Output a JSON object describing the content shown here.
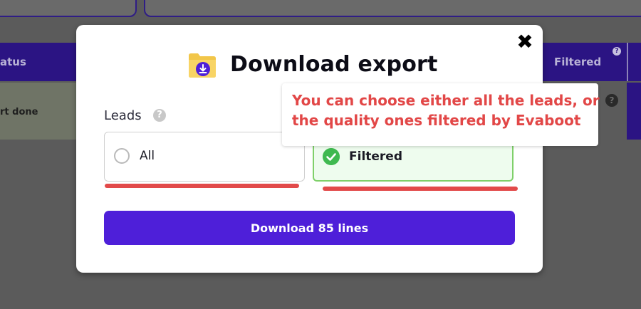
{
  "background": {
    "table_header_left": "atus",
    "table_header_right": "Filtered",
    "header_help": "?",
    "row_status": "rt done",
    "row_help": "?"
  },
  "modal": {
    "title": "Download export",
    "close": "✖",
    "leads_label": "Leads",
    "leads_help": "?",
    "options": [
      {
        "label": "All",
        "selected": false
      },
      {
        "label": "Filtered",
        "selected": true
      }
    ],
    "download_button": "Download 85 lines"
  },
  "annotation": {
    "line1": "You can choose either all the leads, or",
    "line2": "the quality ones filtered by Evaboot",
    "color": "#e24747"
  },
  "colors": {
    "primary": "#4e1fd9",
    "success": "#3fb950",
    "annotation_underline": "#e24a4a",
    "header": "#2b1483"
  },
  "icons": {
    "modal_icon": "folder-download-icon",
    "close": "close-icon",
    "help": "help-icon",
    "check": "check-circle-icon",
    "radio": "radio-empty-icon"
  }
}
